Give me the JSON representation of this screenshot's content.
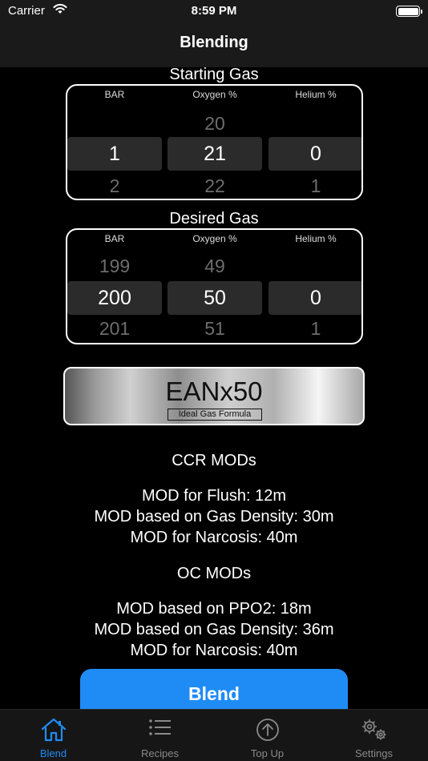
{
  "status_bar": {
    "carrier": "Carrier",
    "time": "8:59 PM"
  },
  "nav": {
    "title": "Blending"
  },
  "starting_gas": {
    "title": "Starting Gas",
    "columns": [
      "BAR",
      "Oxygen %",
      "Helium %"
    ],
    "bar": {
      "above": "",
      "selected": "1",
      "below": "2"
    },
    "oxygen": {
      "above": "20",
      "selected": "21",
      "below": "22"
    },
    "helium": {
      "above": "",
      "selected": "0",
      "below": "1"
    }
  },
  "desired_gas": {
    "title": "Desired Gas",
    "columns": [
      "BAR",
      "Oxygen %",
      "Helium %"
    ],
    "bar": {
      "above": "199",
      "selected": "200",
      "below": "201"
    },
    "oxygen": {
      "above": "49",
      "selected": "50",
      "below": "51"
    },
    "helium": {
      "above": "",
      "selected": "0",
      "below": "1"
    }
  },
  "mix": {
    "name": "EANx50",
    "formula": "Ideal Gas Formula"
  },
  "ccr": {
    "title": "CCR MODs",
    "lines": [
      "MOD for Flush: 12m",
      "MOD based on Gas Density: 30m",
      "MOD for Narcosis: 40m"
    ]
  },
  "oc": {
    "title": "OC MODs",
    "lines": [
      "MOD based on PPO2: 18m",
      "MOD based on Gas Density: 36m",
      "MOD for Narcosis: 40m"
    ]
  },
  "blend_button": "Blend",
  "tabs": [
    {
      "label": "Blend",
      "icon": "home-icon",
      "active": true
    },
    {
      "label": "Recipes",
      "icon": "list-icon",
      "active": false
    },
    {
      "label": "Top Up",
      "icon": "arrow-up-circle-icon",
      "active": false
    },
    {
      "label": "Settings",
      "icon": "gears-icon",
      "active": false
    }
  ],
  "colors": {
    "accent": "#1f8cf5",
    "background": "#000000",
    "bar": "#1a1a1a"
  }
}
